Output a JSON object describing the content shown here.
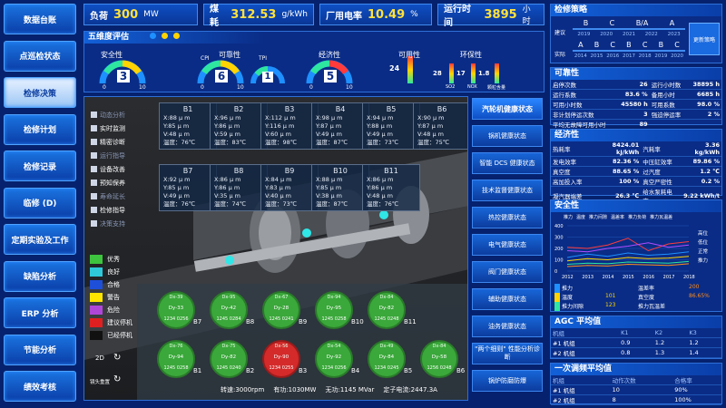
{
  "nav": [
    "数据台账",
    "点巡检状态",
    "检修决策",
    "检修计划",
    "检修记录",
    "临修 (D)",
    "定期实验及工作",
    "缺陷分析",
    "ERP 分析",
    "节能分析",
    "绩效考核"
  ],
  "kpis": [
    {
      "label": "负荷",
      "value": "300",
      "unit": "MW"
    },
    {
      "label": "煤耗",
      "value": "312.53",
      "unit": "g/kWh"
    },
    {
      "label": "厂用电率",
      "value": "10.49",
      "unit": "%"
    },
    {
      "label": "运行时间",
      "value": "3895",
      "unit": "小时"
    }
  ],
  "eval": {
    "title": "五维度评估",
    "dots": [
      "#1e90ff",
      "#ffd400",
      "#ffd400"
    ],
    "items": [
      {
        "label": "安全性",
        "value": "3"
      },
      {
        "label": "可靠性",
        "sub1": "CPI",
        "sub2": "TPI",
        "value": "6",
        "value2": "1"
      },
      {
        "label": "经济性",
        "value": "5"
      },
      {
        "label": "可用性",
        "value": "24"
      },
      {
        "label": "环保性"
      }
    ],
    "scale0": "0",
    "scale10": "10",
    "env": {
      "so2": "28",
      "nox": "17",
      "dust": "1.8",
      "so2_lbl": "SO2",
      "nox_lbl": "NOX",
      "dust_lbl": "颗粒含量"
    }
  },
  "side_menu": [
    "动态分析",
    "实时监测",
    "精密诊断",
    "运行指导",
    "设备改善",
    "预知保养",
    "寿命延长",
    "检修指导",
    "决策支持"
  ],
  "legend": [
    {
      "label": "优秀",
      "color": "#3ec43e"
    },
    {
      "label": "良好",
      "color": "#2ec8d8"
    },
    {
      "label": "合格",
      "color": "#1e4fd8"
    },
    {
      "label": "警告",
      "color": "#ffe600"
    },
    {
      "label": "危险",
      "color": "#b046d8"
    },
    {
      "label": "建议停机",
      "color": "#e02020"
    },
    {
      "label": "已经停机",
      "color": "#111111"
    }
  ],
  "view_2d": "2D",
  "view_reset": "镜头重置",
  "bearings_top": [
    {
      "name": "B1",
      "x": "X:88 μ m",
      "y": "Y:85 μ m",
      "v": "V:48 μ m",
      "t": "温度：76℃"
    },
    {
      "name": "B2",
      "x": "X:96 μ m",
      "y": "Y:86 μ m",
      "v": "V:59 μ m",
      "t": "温度：83℃"
    },
    {
      "name": "B3",
      "x": "X:112 μ m",
      "y": "Y:116 μ m",
      "v": "V:60 μ m",
      "t": "温度：98℃"
    },
    {
      "name": "B4",
      "x": "X:98 μ m",
      "y": "Y:87 μ m",
      "v": "V:49 μ m",
      "t": "温度：87℃"
    },
    {
      "name": "B5",
      "x": "X:94 μ m",
      "y": "Y:88 μ m",
      "v": "V:49 μ m",
      "t": "温度：73℃"
    },
    {
      "name": "B6",
      "x": "X:90 μ m",
      "y": "Y:87 μ m",
      "v": "V:48 μ m",
      "t": "温度：75℃"
    }
  ],
  "bearings_bot": [
    {
      "name": "B7",
      "x": "X:92 μ m",
      "y": "Y:85 μ m",
      "v": "V:49 μ m",
      "t": "温度：76℃"
    },
    {
      "name": "B8",
      "x": "X:86 μ m",
      "y": "Y:86 μ m",
      "v": "V:35 μ m",
      "t": "温度：74℃"
    },
    {
      "name": "B9",
      "x": "X:84 μ m",
      "y": "Y:83 μ m",
      "v": "V:40 μ m",
      "t": "温度：73℃"
    },
    {
      "name": "B10",
      "x": "X:88 μ m",
      "y": "Y:85 μ m",
      "v": "V:38 μ m",
      "t": "温度：87℃"
    },
    {
      "name": "B11",
      "x": "X:86 μ m",
      "y": "Y:86 μ m",
      "v": "V:48 μ m",
      "t": "温度：76℃"
    }
  ],
  "scene_labels": [
    "B1",
    "B2",
    "B3",
    "B4",
    "B5",
    "B6",
    "B7",
    "B8",
    "B9",
    "B10",
    "B11",
    "B5"
  ],
  "circles_top": [
    {
      "id": "B7",
      "a": "Dx-39",
      "b": "Dy-33",
      "c": "1234",
      "d": "0256"
    },
    {
      "id": "B8",
      "a": "Dx-95",
      "b": "Dy-42",
      "c": "1245",
      "d": "0284"
    },
    {
      "id": "B9",
      "a": "Dx-67",
      "b": "Dy-28",
      "c": "1245",
      "d": "0241"
    },
    {
      "id": "B10",
      "a": "Dx-94",
      "b": "Dy-95",
      "c": "1245",
      "d": "0258"
    },
    {
      "id": "B11",
      "a": "Dx-84",
      "b": "Dy-82",
      "c": "1245",
      "d": "0248"
    }
  ],
  "circles_bot": [
    {
      "id": "B1",
      "a": "Dx-76",
      "b": "Dy-94",
      "c": "1245",
      "d": "0258",
      "red": false
    },
    {
      "id": "B2",
      "a": "Dx-75",
      "b": "Dy-82",
      "c": "1245",
      "d": "0240",
      "red": false
    },
    {
      "id": "B3",
      "a": "Dx-56",
      "b": "Dy-90",
      "c": "1234",
      "d": "0255",
      "red": true
    },
    {
      "id": "B4",
      "a": "Dx-54",
      "b": "Dy-92",
      "c": "1234",
      "d": "0256",
      "red": false
    },
    {
      "id": "B5",
      "a": "Dx-49",
      "b": "Dy-84",
      "c": "1234",
      "d": "0245",
      "red": false
    },
    {
      "id": "B6",
      "a": "Dx-84",
      "b": "Dy-58",
      "c": "1256",
      "d": "0248",
      "red": false
    }
  ],
  "footer": {
    "speed": "转速:3000rpm",
    "active": "有功:1030MW",
    "reactive": "无功:1145 MVar",
    "stator": "定子电流:2447.3A"
  },
  "status_buttons": [
    "汽轮机健康状态",
    "锅机健康状态",
    "智能 DCS 健康状态",
    "技术监督健康状态",
    "热控健康状态",
    "电气健康状态",
    "阀门健康状态",
    "辅助健康状态",
    "油务健康状态",
    "\"两个细则\" 性能分析诊断",
    "锅炉防磨防爆"
  ],
  "strategy": {
    "title": "检修策略",
    "row1": [
      "B",
      "C",
      "B/A",
      "A"
    ],
    "years1": [
      "2019",
      "2020",
      "2021",
      "2022",
      "2023"
    ],
    "row2": [
      "A",
      "B",
      "C",
      "B",
      "C",
      "B",
      "C"
    ],
    "years2": [
      "2014",
      "2015",
      "2016",
      "2017",
      "2018",
      "2019",
      "2020"
    ],
    "lbl1": "建议",
    "lbl2": "实际",
    "button": "更新策略"
  },
  "reliability": {
    "title": "可靠性",
    "rows": [
      [
        "启停次数",
        "26",
        "运行小时数",
        "38895 h"
      ],
      [
        "运行系数",
        "83.6 %",
        "备用小时",
        "6685 h"
      ],
      [
        "可用小时数",
        "45580 h",
        "可用系数",
        "98.0 %"
      ],
      [
        "非计划停运次数",
        "3",
        "强迫停运率",
        "2 %"
      ],
      [
        "平均无故障可用小时",
        "89",
        "",
        ""
      ]
    ]
  },
  "economy": {
    "title": "经济性",
    "rows": [
      [
        "热耗率",
        "8424.01 kJ/kWh",
        "汽耗率",
        "3.36 kg/kWh"
      ],
      [
        "发电效率",
        "82.36 %",
        "中压缸效率",
        "89.86 %"
      ],
      [
        "真空度",
        "88.65 %",
        "过汽度",
        "1.2 ℃"
      ],
      [
        "高加投入率",
        "100 %",
        "真空严密性",
        "0.2 %"
      ],
      [
        "凝汽器端差",
        "26.3 ℃",
        "给水泵耗电率",
        "9.22 kWh/t"
      ],
      [
        "给水泵耗用率",
        "3.6 %",
        "",
        ""
      ]
    ]
  },
  "safety": {
    "title": "安全性",
    "chart_data": {
      "type": "line",
      "x": [
        "2012",
        "2013",
        "2014",
        "2015",
        "2016",
        "2017",
        "2018"
      ],
      "ylim": [
        0,
        400
      ],
      "yticks": [
        "0",
        "100",
        "200",
        "300",
        "400"
      ],
      "legend": [
        "推力",
        "温度",
        "推力间隙",
        "温差率",
        "推力负荷",
        "推力瓦温差"
      ],
      "series": [
        {
          "name": "推力",
          "color": "#1e90ff",
          "values": [
            120,
            150,
            130,
            160,
            140,
            150,
            170
          ]
        },
        {
          "name": "温度",
          "color": "#ffd400",
          "values": [
            90,
            110,
            100,
            120,
            110,
            115,
            130
          ]
        },
        {
          "name": "推力间隙",
          "color": "#ff3b3b",
          "values": [
            210,
            200,
            230,
            290,
            180,
            240,
            260
          ]
        },
        {
          "name": "温差率",
          "color": "#b04dff",
          "values": [
            180,
            170,
            200,
            220,
            250,
            210,
            230
          ]
        },
        {
          "name": "推力负荷",
          "color": "#2ee6a0",
          "values": [
            60,
            70,
            65,
            80,
            75,
            70,
            85
          ]
        },
        {
          "name": "推力瓦温差",
          "color": "#ff8c1a",
          "values": [
            40,
            50,
            45,
            60,
            55,
            50,
            65
          ]
        }
      ],
      "right_legend": [
        "高位",
        "低位",
        "正常",
        "推力"
      ]
    },
    "table": [
      {
        "label": "推力",
        "value": "",
        "val2": "",
        "label2": "温差率",
        "v2": "200",
        "color": "#1e90ff"
      },
      {
        "label": "温度",
        "value": "101",
        "label2": "真空度",
        "v2": "86.65%",
        "color": "#ffd400"
      },
      {
        "label": "推力间隙",
        "value": "123",
        "label2": "推力瓦温差",
        "v2": "",
        "color": "#2ee6a0"
      }
    ]
  },
  "agc": {
    "title": "AGC 平均值",
    "headers": [
      "机组",
      "K1",
      "K2",
      "K3"
    ],
    "rows": [
      [
        "#1 机组",
        "0.9",
        "1.2",
        "1.2"
      ],
      [
        "#2 机组",
        "0.8",
        "1.3",
        "1.4"
      ]
    ]
  },
  "freq": {
    "title": "一次调频平均值",
    "headers": [
      "机组",
      "动作次数",
      "合格率"
    ],
    "rows": [
      [
        "#1 机组",
        "10",
        "90%"
      ],
      [
        "#2 机组",
        "8",
        "100%"
      ]
    ]
  }
}
